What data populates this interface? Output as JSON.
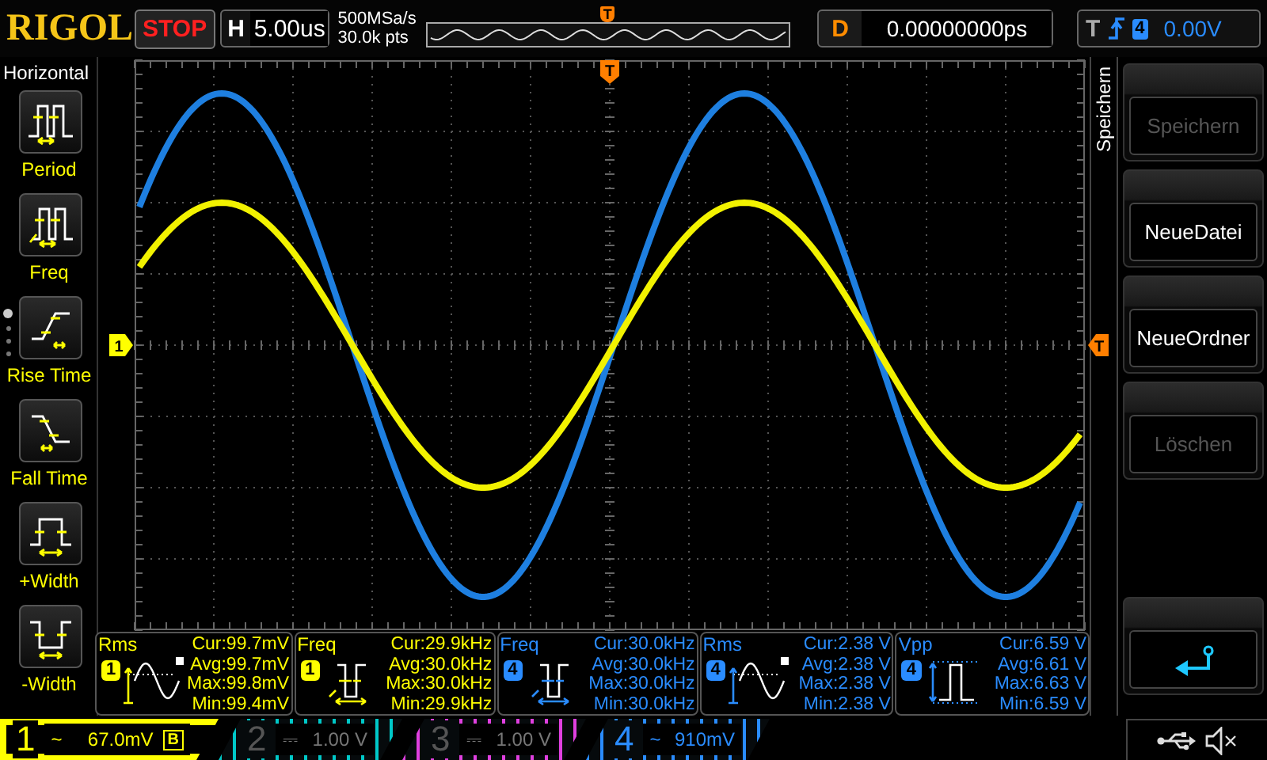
{
  "top_bar": {
    "logo": "RIGOL",
    "run_state": "STOP",
    "timebase": {
      "label": "H",
      "value": "5.00us"
    },
    "sample_rate": "500MSa/s",
    "memory_depth": "30.0k pts",
    "memory_trigger_marker": "T",
    "delay": {
      "label": "D",
      "value": "0.00000000ps"
    },
    "trigger": {
      "label": "T",
      "source": "4",
      "level": "0.00V"
    }
  },
  "left_menu": {
    "title": "Horizontal",
    "items": [
      {
        "kind": "period",
        "label": "Period"
      },
      {
        "kind": "freq",
        "label": "Freq"
      },
      {
        "kind": "rise",
        "label": "Rise Time"
      },
      {
        "kind": "fall",
        "label": "Fall Time"
      },
      {
        "kind": "pwidth",
        "label": "+Width"
      },
      {
        "kind": "nwidth",
        "label": "-Width"
      }
    ],
    "pages": [
      {
        "selected": true
      },
      {
        "selected": false
      },
      {
        "selected": false
      },
      {
        "selected": false
      }
    ]
  },
  "scope": {
    "trigger_position_marker": "T",
    "channel_marker": "1",
    "trigger_level_marker": "T"
  },
  "measurements": [
    {
      "name": "Rms",
      "channel": "1",
      "color": "#ffff00",
      "kind": "rms",
      "lines": [
        "Cur:99.7mV",
        "Avg:99.7mV",
        "Max:99.8mV",
        "Min:99.4mV"
      ]
    },
    {
      "name": "Freq",
      "channel": "1",
      "color": "#ffff00",
      "kind": "freq",
      "lines": [
        "Cur:29.9kHz",
        "Avg:30.0kHz",
        "Max:30.0kHz",
        "Min:29.9kHz"
      ]
    },
    {
      "name": "Freq",
      "channel": "4",
      "color": "#2a8cff",
      "kind": "freq",
      "lines": [
        "Cur:30.0kHz",
        "Avg:30.0kHz",
        "Max:30.0kHz",
        "Min:30.0kHz"
      ]
    },
    {
      "name": "Rms",
      "channel": "4",
      "color": "#2a8cff",
      "kind": "rms",
      "lines": [
        "Cur:2.38 V",
        "Avg:2.38 V",
        "Max:2.38 V",
        "Min:2.38 V"
      ]
    },
    {
      "name": "Vpp",
      "channel": "4",
      "color": "#2a8cff",
      "kind": "vpp",
      "lines": [
        "Cur:6.59 V",
        "Avg:6.61 V",
        "Max:6.63 V",
        "Min:6.59 V"
      ]
    }
  ],
  "channels": [
    {
      "number": "1",
      "coupling": "~",
      "scale": "67.0mV",
      "bandwidth_limit": "B",
      "selected": true,
      "on": true,
      "color": "#ffff00"
    },
    {
      "number": "2",
      "coupling": "⎓",
      "scale": "1.00 V",
      "selected": false,
      "on": false,
      "color": "#00c8c8"
    },
    {
      "number": "3",
      "coupling": "⎓",
      "scale": "1.00 V",
      "selected": false,
      "on": false,
      "color": "#e040e0"
    },
    {
      "number": "4",
      "coupling": "~",
      "scale": "910mV",
      "selected": false,
      "on": true,
      "color": "#2a8cff"
    }
  ],
  "right_menu": {
    "title": "Speichern",
    "buttons": [
      {
        "kind": "text",
        "label": "Speichern",
        "disabled": true
      },
      {
        "kind": "text",
        "label": "NeueDatei",
        "disabled": false
      },
      {
        "kind": "text",
        "label": "NeueOrdner",
        "disabled": false
      },
      {
        "kind": "text",
        "label": "Löschen",
        "disabled": true
      },
      {
        "kind": "back"
      }
    ]
  }
}
